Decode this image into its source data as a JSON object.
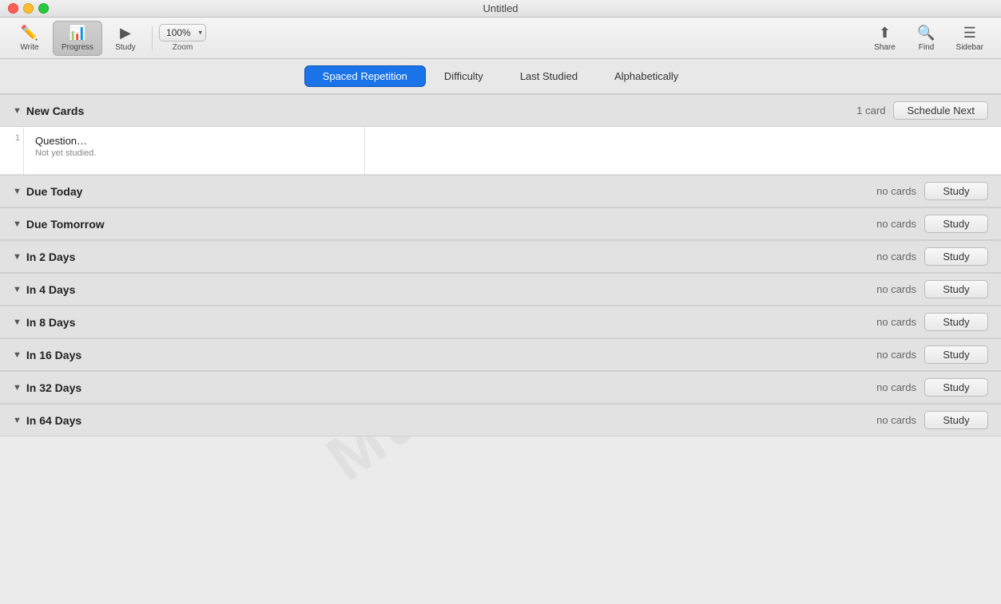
{
  "window": {
    "title": "Untitled"
  },
  "toolbar": {
    "write_label": "Write",
    "progress_label": "Progress",
    "study_label": "Study",
    "zoom_value": "100%",
    "zoom_label": "Zoom",
    "share_label": "Share",
    "find_label": "Find",
    "sidebar_label": "Sidebar"
  },
  "tabs": [
    {
      "id": "spaced-repetition",
      "label": "Spaced Repetition",
      "active": true
    },
    {
      "id": "difficulty",
      "label": "Difficulty",
      "active": false
    },
    {
      "id": "last-studied",
      "label": "Last Studied",
      "active": false
    },
    {
      "id": "alphabetically",
      "label": "Alphabetically",
      "active": false
    }
  ],
  "sections": [
    {
      "id": "new-cards",
      "title": "New Cards",
      "card_count": "1 card",
      "button_label": "Schedule Next",
      "has_cards": true,
      "cards": [
        {
          "number": "1",
          "question": "Question…",
          "status": "Not yet studied."
        }
      ]
    },
    {
      "id": "due-today",
      "title": "Due Today",
      "card_count": "no cards",
      "button_label": "Study",
      "has_cards": false
    },
    {
      "id": "due-tomorrow",
      "title": "Due Tomorrow",
      "card_count": "no cards",
      "button_label": "Study",
      "has_cards": false
    },
    {
      "id": "in-2-days",
      "title": "In 2 Days",
      "card_count": "no cards",
      "button_label": "Study",
      "has_cards": false
    },
    {
      "id": "in-4-days",
      "title": "In 4 Days",
      "card_count": "no cards",
      "button_label": "Study",
      "has_cards": false
    },
    {
      "id": "in-8-days",
      "title": "In 8 Days",
      "card_count": "no cards",
      "button_label": "Study",
      "has_cards": false
    },
    {
      "id": "in-16-days",
      "title": "In 16 Days",
      "card_count": "no cards",
      "button_label": "Study",
      "has_cards": false
    },
    {
      "id": "in-32-days",
      "title": "In 32 Days",
      "card_count": "no cards",
      "button_label": "Study",
      "has_cards": false
    },
    {
      "id": "in-64-days",
      "title": "In 64 Days",
      "card_count": "no cards",
      "button_label": "Study",
      "has_cards": false
    }
  ],
  "watermark": "MacStories"
}
